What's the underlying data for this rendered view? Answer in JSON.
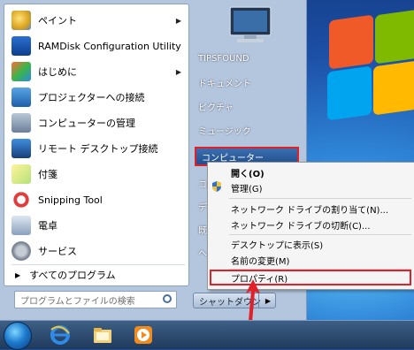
{
  "start_menu": {
    "programs": [
      {
        "label": "ペイント",
        "icon": "paint-icon",
        "has_submenu": true
      },
      {
        "label": "RAMDisk Configuration Utility",
        "icon": "ramdisk-icon",
        "has_submenu": false
      },
      {
        "label": "はじめに",
        "icon": "getting-started-icon",
        "has_submenu": true
      },
      {
        "label": "プロジェクターへの接続",
        "icon": "projector-icon",
        "has_submenu": false
      },
      {
        "label": "コンピューターの管理",
        "icon": "computer-management-icon",
        "has_submenu": false
      },
      {
        "label": "リモート デスクトップ接続",
        "icon": "remote-desktop-icon",
        "has_submenu": false
      },
      {
        "label": "付箋",
        "icon": "sticky-notes-icon",
        "has_submenu": false
      },
      {
        "label": "Snipping Tool",
        "icon": "snipping-tool-icon",
        "has_submenu": false
      },
      {
        "label": "電卓",
        "icon": "calculator-icon",
        "has_submenu": false
      },
      {
        "label": "サービス",
        "icon": "services-icon",
        "has_submenu": false
      }
    ],
    "all_programs": "すべてのプログラム",
    "search_placeholder": "プログラムとファイルの検索",
    "right_items": {
      "user": "TIPSFOUND",
      "documents": "ドキュメント",
      "pictures": "ピクチャ",
      "music": "ミュージック",
      "computer": "コンピューター"
    },
    "shutdown_label": "シャットダウン"
  },
  "context_menu": {
    "open": "開く(O)",
    "manage": "管理(G)",
    "map_drive": "ネットワーク ドライブの割り当て(N)...",
    "disconnect_drive": "ネットワーク ドライブの切断(C)...",
    "show_desktop": "デスクトップに表示(S)",
    "rename": "名前の変更(M)",
    "properties": "プロパティ(R)"
  },
  "colors": {
    "highlight_border": "#e0212a",
    "accent": "#204f8e"
  }
}
